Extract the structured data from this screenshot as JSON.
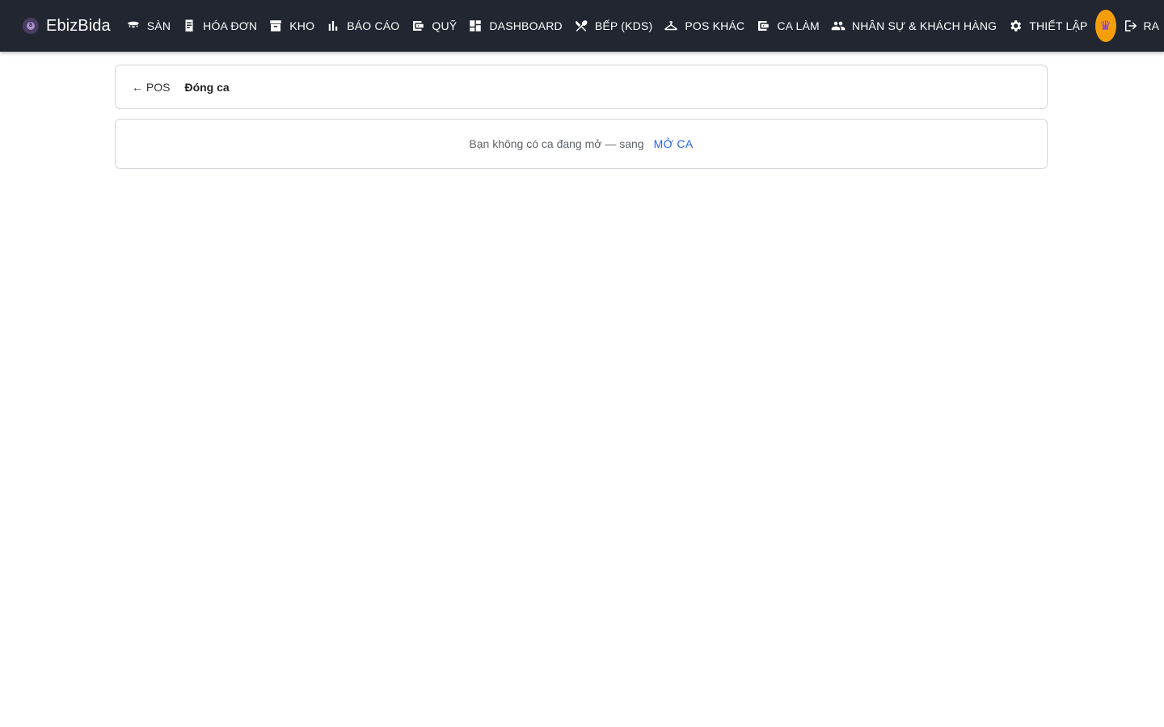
{
  "app": {
    "brand": "EbizBida"
  },
  "nav": [
    {
      "label": "SÀN",
      "icon": "table-icon"
    },
    {
      "label": "HÓA ĐƠN",
      "icon": "receipt-icon"
    },
    {
      "label": "KHO",
      "icon": "archive-icon"
    },
    {
      "label": "BÁO CÁO",
      "icon": "bar-chart-icon"
    },
    {
      "label": "QUỸ",
      "icon": "wallet-icon"
    },
    {
      "label": "DASHBOARD",
      "icon": "dashboard-icon"
    },
    {
      "label": "BẾP (KDS)",
      "icon": "cutlery-icon"
    },
    {
      "label": "POS KHÁC",
      "icon": "hanger-icon"
    },
    {
      "label": "CA LÀM",
      "icon": "wallet-icon"
    },
    {
      "label": "NHÂN SỰ & KHÁCH HÀNG",
      "icon": "people-icon"
    },
    {
      "label": "THIẾT LẬP",
      "icon": "gear-icon"
    }
  ],
  "user": {
    "avatar_icon": "crown-icon",
    "avatar_color": "#f59e0b"
  },
  "logout": {
    "label": "RA",
    "icon": "logout-icon"
  },
  "header": {
    "back_label": "← POS",
    "title": "Đóng ca"
  },
  "body": {
    "message": "Bạn không có ca đang mở — sang",
    "open_shift_label": "MỞ CA"
  },
  "colors": {
    "topbar": "#212631",
    "link": "#2563eb",
    "accent": "#f59e0b"
  }
}
